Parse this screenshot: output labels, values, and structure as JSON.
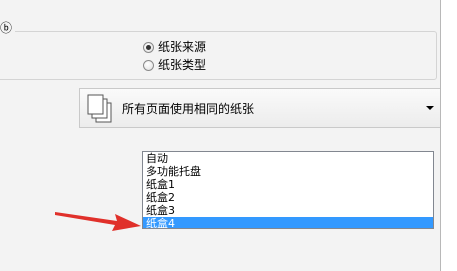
{
  "group": {
    "label": "ⓑ"
  },
  "source_options": {
    "items": [
      {
        "label": "纸张来源",
        "checked": true
      },
      {
        "label": "纸张类型",
        "checked": false
      }
    ]
  },
  "paper_combo": {
    "selected": "所有页面使用相同的纸张",
    "icon": "paper-stack-icon"
  },
  "tray_list": {
    "items": [
      "自动",
      "多功能托盘",
      "纸盒1",
      "纸盒2",
      "纸盒3",
      "纸盒4"
    ],
    "selected_index": 5
  },
  "annotation": {
    "arrow_color": "#e0302a",
    "icon": "red-arrow-icon"
  },
  "colors": {
    "selection": "#3399ff",
    "background": "#f3f3f3"
  }
}
